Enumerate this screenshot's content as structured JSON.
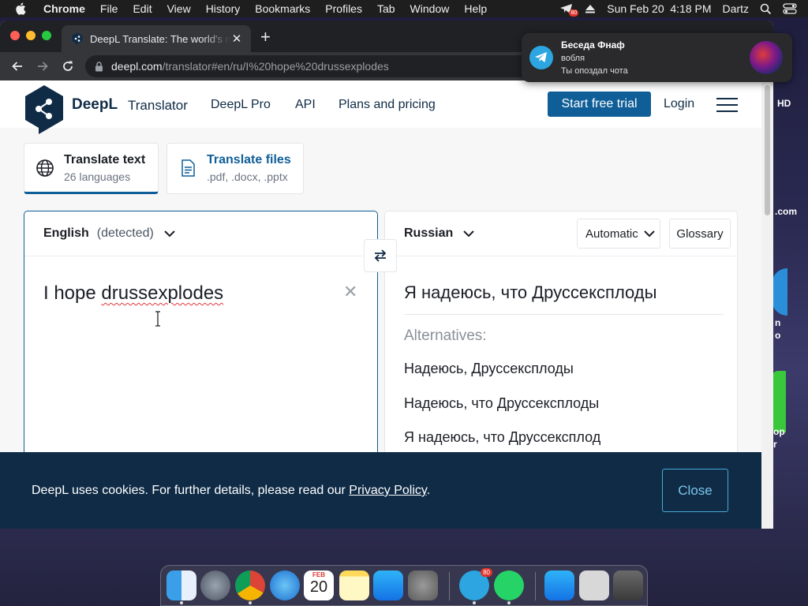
{
  "menubar": {
    "app_name": "Chrome",
    "items": [
      "File",
      "Edit",
      "View",
      "History",
      "Bookmarks",
      "Profiles",
      "Tab",
      "Window",
      "Help"
    ],
    "tray_badge": "80",
    "datetime": "Sun Feb 20  4:18 PM",
    "user": "Dartz"
  },
  "browser": {
    "tab_title": "DeepL Translate: The world's most accurate translator",
    "url_host": "deepl.com",
    "url_path": "/translator#en/ru/I%20hope%20drussexplodes"
  },
  "site": {
    "logo_text": "DeepL",
    "logo_sub": "Translator",
    "nav": [
      "DeepL Pro",
      "API",
      "Plans and pricing"
    ],
    "cta": "Start free trial",
    "login": "Login"
  },
  "modes": {
    "text_title": "Translate text",
    "text_sub": "26 languages",
    "files_title": "Translate files",
    "files_sub": ".pdf, .docx, .pptx"
  },
  "source": {
    "language": "English",
    "detected": "(detected)",
    "text_plain": "I hope ",
    "text_misspelled": "drussexplodes"
  },
  "target": {
    "language": "Russian",
    "formality": "Automatic",
    "glossary": "Glossary",
    "translation": "Я надеюсь, что Друссексплоды",
    "alternatives_label": "Alternatives:",
    "alternatives": [
      "Надеюсь, Друссексплоды",
      "Надеюсь, что Друссексплоды",
      "Я надеюсь, что Друссексплод"
    ]
  },
  "cookie": {
    "text": "DeepL uses cookies. For further details, please read our ",
    "link": "Privacy Policy",
    "suffix": ".",
    "close": "Close"
  },
  "notification": {
    "title": "Беседа Фнаф",
    "sender": "вобля",
    "message": "Ты опоздал чота"
  },
  "desktop": {
    "fragments": [
      "HD",
      ".com",
      "n",
      "o",
      "op",
      "r"
    ]
  },
  "dock": {
    "telegram_badge": "80",
    "calendar_month": "FEB",
    "calendar_day": "20"
  },
  "colors": {
    "deepl_navy": "#0f2b46",
    "deepl_blue": "#0f5e97",
    "cookie_banner": "#0f2b46"
  }
}
